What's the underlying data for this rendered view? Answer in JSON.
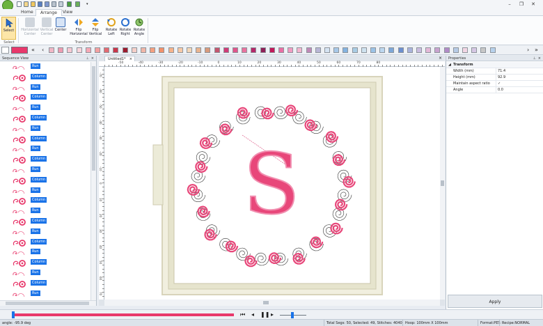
{
  "titlebar": {
    "minimize": "–",
    "restore": "❐",
    "close": "✕"
  },
  "tabs": [
    {
      "label": "Home"
    },
    {
      "label": "Arrange"
    },
    {
      "label": "View"
    }
  ],
  "ribbon": {
    "select_label": "Select",
    "select_group": "Select",
    "transform_group": "Transform",
    "buttons": [
      {
        "label": "Horizontal Center",
        "line1": "Horizontal",
        "line2": "Center"
      },
      {
        "label": "Vertical Center",
        "line1": "Vertical",
        "line2": "Center"
      },
      {
        "label": "Center",
        "line1": "Center",
        "line2": ""
      },
      {
        "label": "Flip Horizontal",
        "line1": "Flip",
        "line2": "Horizontal"
      },
      {
        "label": "Flip Vertical",
        "line1": "Flip",
        "line2": "Vertical"
      },
      {
        "label": "Rotate Left",
        "line1": "Rotate",
        "line2": "Left"
      },
      {
        "label": "Rotate Right",
        "line1": "Rotate",
        "line2": "Right"
      },
      {
        "label": "Rotate Angle",
        "line1": "Rotate",
        "line2": "Angle"
      }
    ]
  },
  "colors": [
    "#f1b7c5",
    "#ee9cb0",
    "#f7c9d3",
    "#fad6dc",
    "#f7a8b5",
    "#f4a0a0",
    "#e36a72",
    "#c9364a",
    "#9c1c2e",
    "#f5cfc8",
    "#f0b6a7",
    "#f4a07f",
    "#f2916a",
    "#f6b38a",
    "#f7c9a6",
    "#f3d7b8",
    "#e9b48f",
    "#d89a7c",
    "#c4566f",
    "#d03b77",
    "#e0558b",
    "#e9729f",
    "#b5286a",
    "#8e2058",
    "#c2195a",
    "#ea6fa4",
    "#f29cc2",
    "#f4b6cf",
    "#c08ab8",
    "#b9b7d6",
    "#d5e3f2",
    "#a7c8e8",
    "#84b3e0",
    "#a9cce4",
    "#cfe2ef",
    "#9bc2e6",
    "#bcd7ef",
    "#7da7d8",
    "#6c8fcf",
    "#aab3dc",
    "#cbbde0",
    "#e4b9d8",
    "#c9a3cf",
    "#b28bc7",
    "#b7cbe6",
    "#f2d6e4",
    "#d6c7e4",
    "#c7c7c7",
    "#b7d1ec"
  ],
  "colorbar_active": "#e8386b",
  "sequence": {
    "title": "Sequence View",
    "items": [
      {
        "type": "Run"
      },
      {
        "type": "Column"
      },
      {
        "type": "Run"
      },
      {
        "type": "Column"
      },
      {
        "type": "Run"
      },
      {
        "type": "Column"
      },
      {
        "type": "Run"
      },
      {
        "type": "Column"
      },
      {
        "type": "Run"
      },
      {
        "type": "Column"
      },
      {
        "type": "Run"
      },
      {
        "type": "Column"
      },
      {
        "type": "Run"
      },
      {
        "type": "Column"
      },
      {
        "type": "Run"
      },
      {
        "type": "Column"
      },
      {
        "type": "Run"
      },
      {
        "type": "Column"
      },
      {
        "type": "Run"
      },
      {
        "type": "Column"
      },
      {
        "type": "Run"
      },
      {
        "type": "Column"
      },
      {
        "type": "Run"
      }
    ]
  },
  "document": {
    "tab_label": "Untitled1*",
    "letter": "S"
  },
  "ruler": {
    "top": [
      "-50",
      "-40",
      "-30",
      "-20",
      "-10",
      "0",
      "10",
      "20",
      "30",
      "40",
      "50",
      "60",
      "70",
      "80"
    ],
    "left": [
      "-70",
      "-60",
      "-50",
      "-40",
      "-30",
      "-20",
      "-10",
      "0",
      "10",
      "20",
      "30",
      "40",
      "50",
      "60",
      "70"
    ]
  },
  "properties": {
    "title": "Properties",
    "section": "Transform",
    "rows": [
      {
        "label": "Width (mm)",
        "value": "71.4"
      },
      {
        "label": "Height (mm)",
        "value": "92.9"
      },
      {
        "label": "Maintain aspect ratio",
        "value": "✓"
      },
      {
        "label": "Angle",
        "value": "0.0"
      }
    ],
    "apply_label": "Apply"
  },
  "status": {
    "angle": "angle: -95.9 deg",
    "segs": "Total Segs: 50, Selected: 49, Stitches: 4040",
    "hoop": "Hoop: 100mm X 100mm",
    "format": "Format:PES",
    "recipe": "Recipe:NORMAL"
  },
  "accent": "#e8386b",
  "selection_blue": "#1a73e8"
}
